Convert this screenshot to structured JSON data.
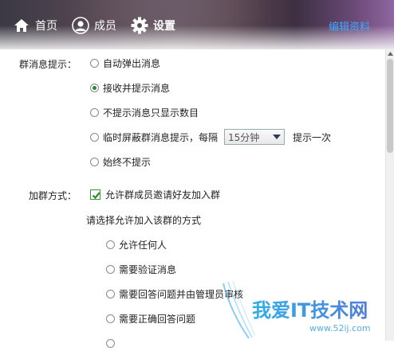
{
  "nav": {
    "home": "首页",
    "members": "成员",
    "settings": "设置",
    "edit": "编辑资料"
  },
  "group_msg": {
    "label": "群消息提示：",
    "options": [
      "自动弹出消息",
      "接收并提示消息",
      "不提示消息只显示数目",
      "临时屏蔽群消息提示，每隔",
      "始终不提示"
    ],
    "selected_index": 1,
    "interval_value": "15分钟",
    "interval_suffix": "提示一次"
  },
  "join": {
    "label": "加群方式：",
    "allow_invite": "允许群成员邀请好友加入群",
    "allow_invite_checked": true,
    "choose_prompt": "请选择允许加入该群的方式",
    "options": [
      "允许任何人",
      "需要验证消息",
      "需要回答问题并由管理员审核",
      "需要正确回答问题"
    ]
  },
  "watermark": {
    "title": "我爱IT技术网",
    "url": "www.52ij.com"
  },
  "colors": {
    "link": "#3fa8ff",
    "radio_dot": "#1f8f2a",
    "check": "#2e8b2e"
  }
}
